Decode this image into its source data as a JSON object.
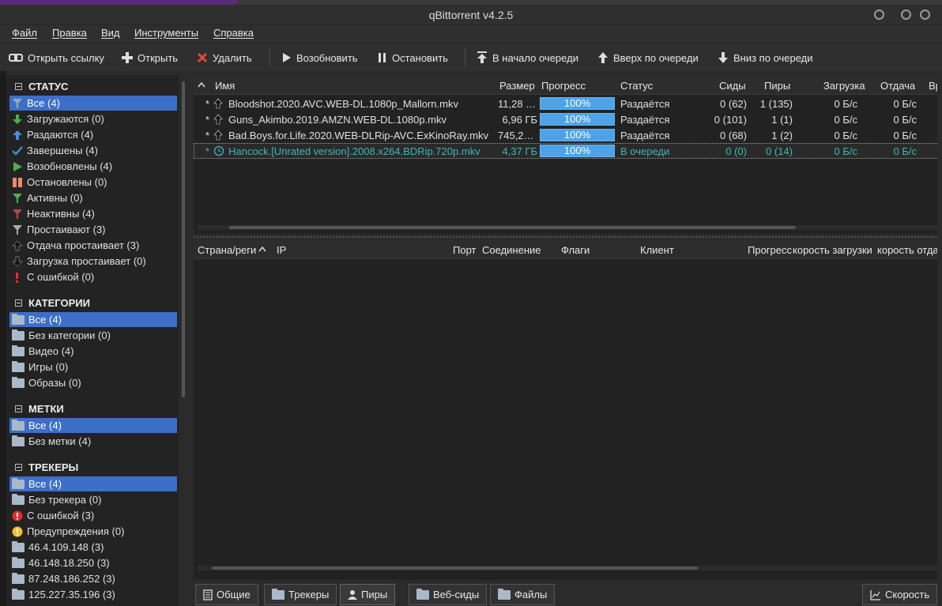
{
  "window": {
    "title": "qBittorrent v4.2.5"
  },
  "menu": [
    "Файл",
    "Правка",
    "Вид",
    "Инструменты",
    "Справка"
  ],
  "toolbar": {
    "open_link": "Открыть ссылку",
    "open": "Открыть",
    "delete": "Удалить",
    "resume": "Возобновить",
    "pause": "Остановить",
    "queue_top": "В начало очереди",
    "queue_up": "Вверх по очереди",
    "queue_down": "Вниз по очереди"
  },
  "sidebar": {
    "status_title": "СТАТУС",
    "status": [
      "Все (4)",
      "Загружаются (0)",
      "Раздаются (4)",
      "Завершены (4)",
      "Возобновлены (4)",
      "Остановлены (0)",
      "Активны (0)",
      "Неактивны (4)",
      "Простаивают (3)",
      "Отдача простаивает (3)",
      "Загрузка простаивает (0)",
      "С ошибкой (0)"
    ],
    "categories_title": "КАТЕГОРИИ",
    "categories": [
      "Все (4)",
      "Без категории (0)",
      "Видео (4)",
      "Игры (0)",
      "Образы (0)"
    ],
    "tags_title": "МЕТКИ",
    "tags": [
      "Все (4)",
      "Без метки (4)"
    ],
    "trackers_title": "ТРЕКЕРЫ",
    "trackers": [
      "Все (4)",
      "Без трекера (0)",
      "С ошибкой (3)",
      "Предупреждения (0)",
      "46.4.109.148 (3)",
      "46.148.18.250 (3)",
      "87.248.186.252 (3)",
      "125.227.35.196 (3)"
    ]
  },
  "torrents": {
    "columns": {
      "name": "Имя",
      "size": "Размер",
      "progress": "Прогресс",
      "status": "Статус",
      "seeds": "Сиды",
      "peers": "Пиры",
      "down": "Загрузка",
      "up": "Отдача",
      "extra": "Вр"
    },
    "rows": [
      {
        "name": "Bloodshot.2020.AVC.WEB-DL.1080p_Mallorn.mkv",
        "size": "11,28 …",
        "progress": "100%",
        "status": "Раздаётся",
        "seeds": "0 (62)",
        "peers": "1 (135)",
        "down": "0 Б/с",
        "up": "0 Б/с"
      },
      {
        "name": "Guns_Akimbo.2019.AMZN.WEB-DL.1080p.mkv",
        "size": "6,96 ГБ",
        "progress": "100%",
        "status": "Раздаётся",
        "seeds": "0 (101)",
        "peers": "1 (1)",
        "down": "0 Б/с",
        "up": "0 Б/с"
      },
      {
        "name": "Bad.Boys.for.Life.2020.WEB-DLRip-AVC.ExKinoRay.mkv",
        "size": "745,2…",
        "progress": "100%",
        "status": "Раздаётся",
        "seeds": "0 (68)",
        "peers": "1 (2)",
        "down": "0 Б/с",
        "up": "0 Б/с"
      },
      {
        "name": "Hancock.[Unrated version].2008.x264.BDRip.720p.mkv",
        "size": "4,37 ГБ",
        "progress": "100%",
        "status": "В очереди",
        "seeds": "0 (0)",
        "peers": "0 (14)",
        "down": "0 Б/с",
        "up": "0 Б/с"
      }
    ]
  },
  "peers": {
    "columns": {
      "country": "Страна/реги",
      "ip": "IP",
      "port": "Порт",
      "connection": "Соединение",
      "flags": "Флаги",
      "client": "Клиент",
      "progress": "Прогресс",
      "down_speed": "корость загрузки",
      "up_speed": "корость отда"
    }
  },
  "tabs": {
    "general": "Общие",
    "trackers": "Трекеры",
    "peers": "Пиры",
    "webseeds": "Веб-сиды",
    "files": "Файлы",
    "speed": "Скорость"
  },
  "colors": {
    "selection": "#3d6fc8",
    "progress": "#4da3e8",
    "queued": "#3fb7b7"
  }
}
